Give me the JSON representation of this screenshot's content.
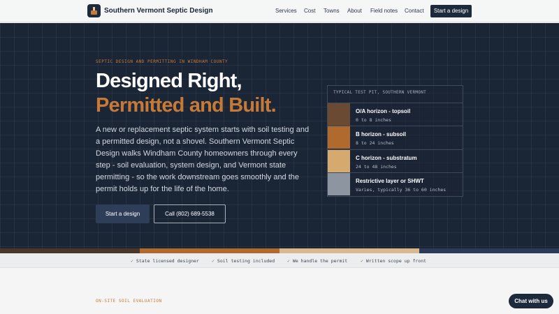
{
  "header": {
    "brand": "Southern Vermont Septic Design",
    "nav": [
      "Services",
      "Cost",
      "Towns",
      "About",
      "Field notes",
      "Contact"
    ],
    "cta": "Start a design"
  },
  "hero": {
    "eyebrow": "SEPTIC DESIGN AND PERMITTING IN WINDHAM COUNTY",
    "headline_1": "Designed Right,",
    "headline_2": "Permitted and Built.",
    "lede": "A new or replacement septic system starts with soil testing and a permitted design, not a shovel. Southern Vermont Septic Design walks Windham County homeowners through every step - soil evaluation, system design, and Vermont state permitting - so the work downstream goes smoothly and the permit holds up for the life of the home.",
    "primary_button": "Start a design",
    "secondary_button": "Call (802) 689-5538"
  },
  "test_pit": {
    "title": "TYPICAL TEST PIT, SOUTHERN VERMONT",
    "layers": [
      {
        "name": "O/A horizon - topsoil",
        "depth": "0 to 8 inches",
        "color": "#6b4a33"
      },
      {
        "name": "B horizon - subsoil",
        "depth": "8 to 24 inches",
        "color": "#b06a2e"
      },
      {
        "name": "C horizon - substratum",
        "depth": "24 to 48 inches",
        "color": "#d6a96e"
      },
      {
        "name": "Restrictive layer or SHWT",
        "depth": "Varies, typically 36 to 60 inches",
        "color": "#8d96a0"
      }
    ]
  },
  "strip_colors": [
    "#4a3526",
    "#b06a2e",
    "#d8b88c",
    "#2a3a58"
  ],
  "trust": [
    "State licensed designer",
    "Soil testing included",
    "We handle the permit",
    "Written scope up front"
  ],
  "next_section": {
    "eyebrow": "ON-SITE SOIL EVALUATION"
  },
  "chat": {
    "label": "Chat with us"
  }
}
